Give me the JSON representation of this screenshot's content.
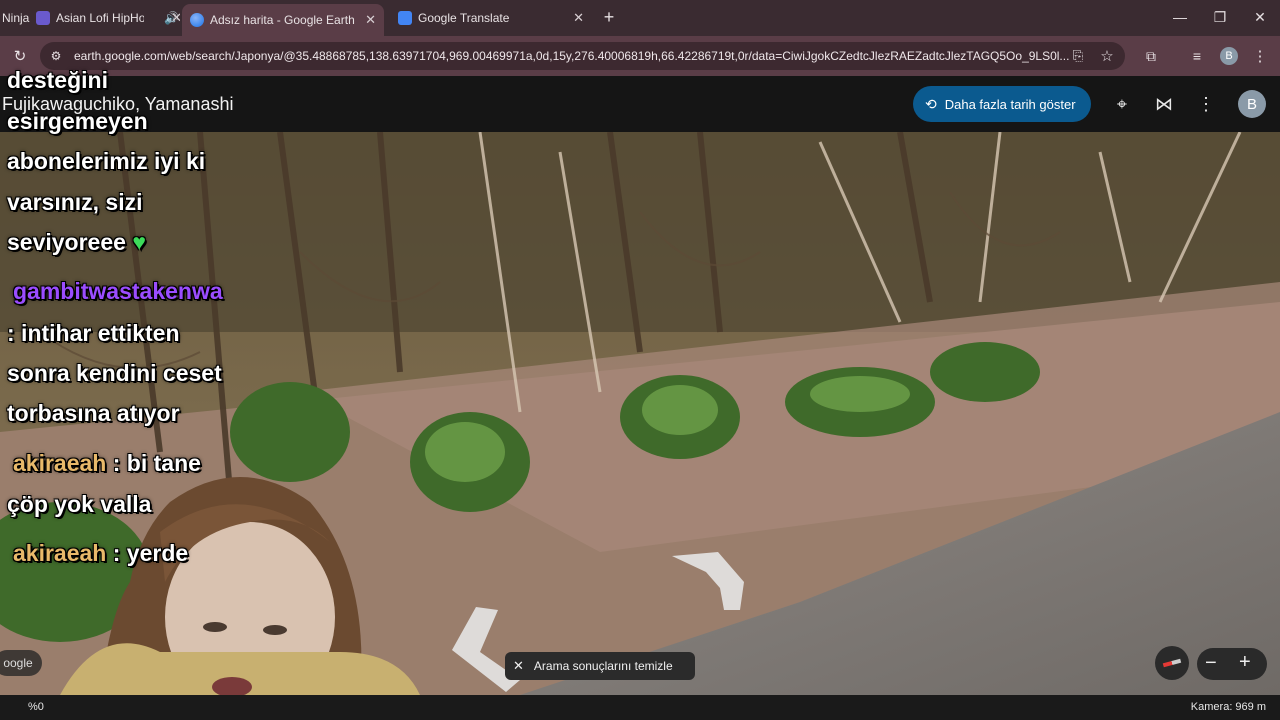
{
  "tabs": [
    {
      "label": "Ninja",
      "active": false
    },
    {
      "label": "Asian Lofi HipHop",
      "active": false
    },
    {
      "label": "Adsız harita - Google Earth",
      "active": true
    },
    {
      "label": "Google Translate",
      "active": false
    }
  ],
  "address_bar": {
    "url": "earth.google.com/web/search/Japonya/@35.48868785,138.63971704,969.00469971a,0d,15y,276.40006819h,66.42286719t,0r/data=CiwiJgokCZedtcJlezRAEZadtcJlezTAGQ5Oo_9LS0l..."
  },
  "profile_initial": "B",
  "earth": {
    "location": "Fujikawaguchiko, Yamanashi",
    "history_button": "Daha fazla tarih göster",
    "clear_search": "Arama sonuçlarını temizle",
    "google_label": "oogle",
    "camera": "Kamera: 969 m",
    "zoom_pct": "%0"
  },
  "chat": {
    "line1": "desteğini",
    "line2": "esirgemeyen",
    "line3": "abonelerimiz iyi ki",
    "line4": "varsınız, sizi",
    "line5": "seviyoreee",
    "user1": "gambitwastakenwa",
    "msg1a": ": intihar ettikten",
    "msg1b": "sonra kendini ceset",
    "msg1c": "torbasına atıyor",
    "user2": "akiraeah",
    "msg2a": ": bi tane",
    "msg2b": "çöp yok valla",
    "user3": "akiraeah",
    "msg3": ": yerde",
    "colors": {
      "user1": "#9b4dff",
      "akira": "#e8b96a"
    }
  }
}
